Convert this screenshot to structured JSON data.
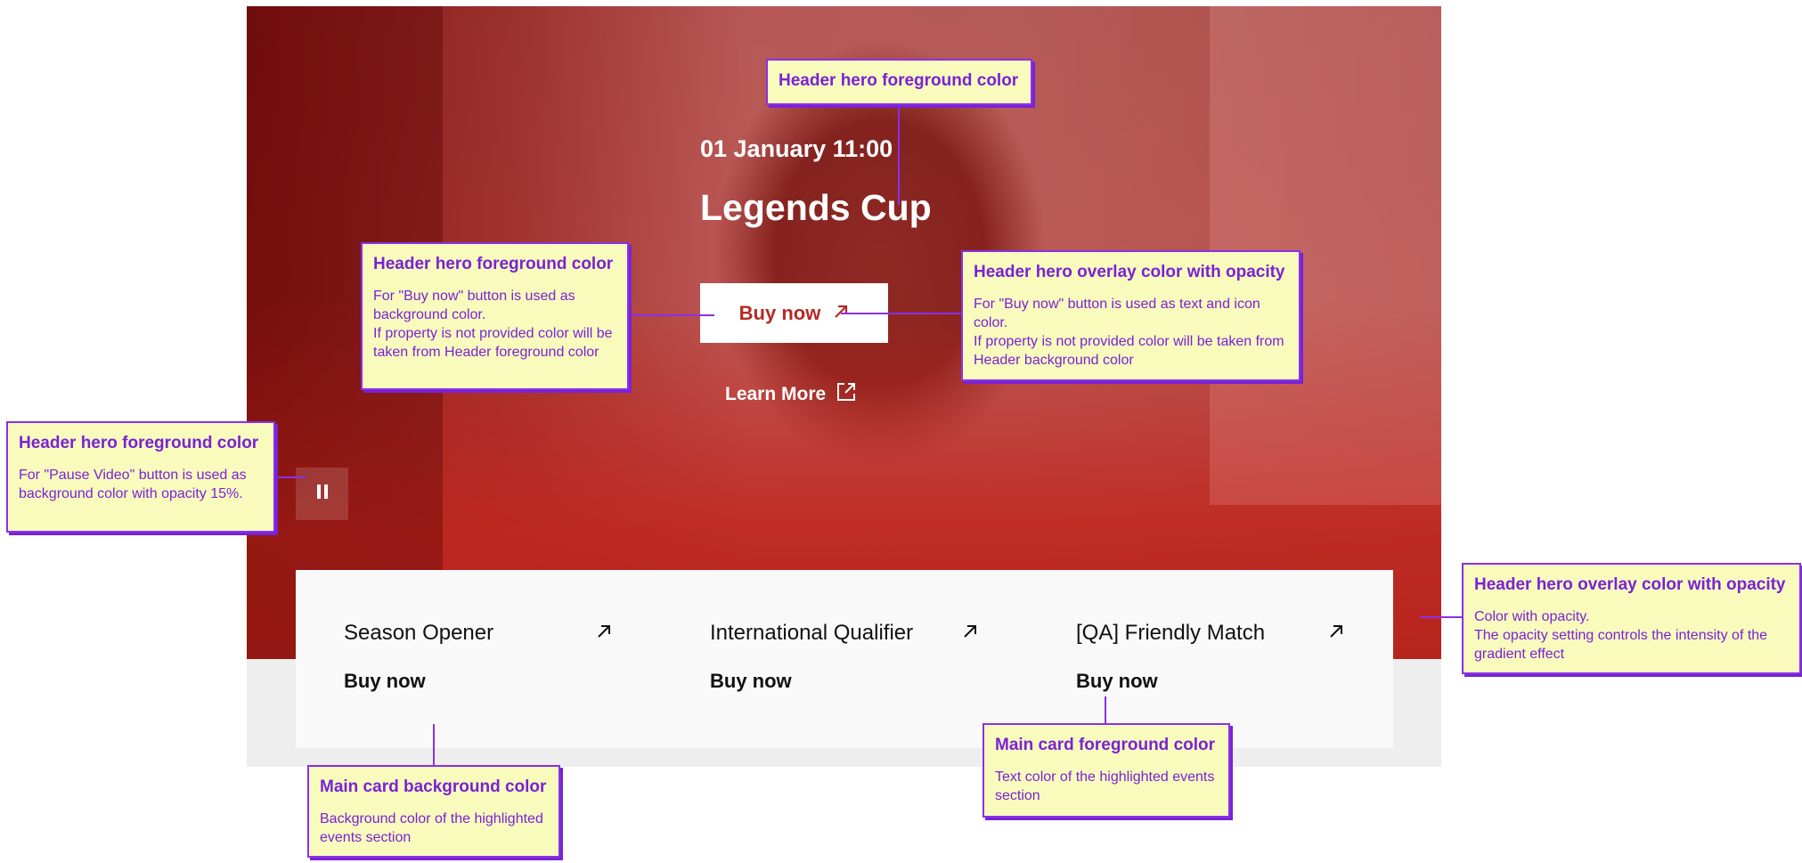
{
  "hero": {
    "date": "01 January 11:00",
    "title": "Legends Cup",
    "buy_label": "Buy now",
    "learn_more_label": "Learn More"
  },
  "events": [
    {
      "title": "Season Opener",
      "buy_label": "Buy now"
    },
    {
      "title": "International Qualifier",
      "buy_label": "Buy now"
    },
    {
      "title": "[QA] Friendly Match",
      "buy_label": "Buy now"
    }
  ],
  "annotations": {
    "top": {
      "title": "Header hero foreground color"
    },
    "buy_bg": {
      "title": "Header hero foreground color",
      "body": "For \"Buy now\" button is used as background color.\nIf property is not provided color will be taken from Header foreground color"
    },
    "buy_text": {
      "title": "Header hero overlay color with opacity",
      "body": "For \"Buy now\" button is used as text and icon color.\nIf property is not provided color will be taken from Header background color"
    },
    "pause": {
      "title": "Header hero foreground color",
      "body": "For \"Pause Video\" button is used as background color with opacity 15%."
    },
    "overlay": {
      "title": "Header hero overlay color with opacity",
      "body": "Color with opacity.\nThe opacity setting controls the intensity of the gradient effect"
    },
    "card_bg": {
      "title": "Main card background color",
      "body": "Background color of the highlighted events section"
    },
    "card_fg": {
      "title": "Main card foreground color",
      "body": "Text color of the highlighted events section"
    }
  },
  "colors": {
    "hero_overlay": "#b7241d",
    "annotation_bg": "#f9fbbd",
    "annotation_border": "#8a30e8",
    "card_bg": "#f9f9f9",
    "card_fg": "#111111"
  },
  "icons": {
    "buy_arrow": "arrow-up-right-icon",
    "learn_more": "external-link-icon",
    "pause": "pause-icon"
  }
}
